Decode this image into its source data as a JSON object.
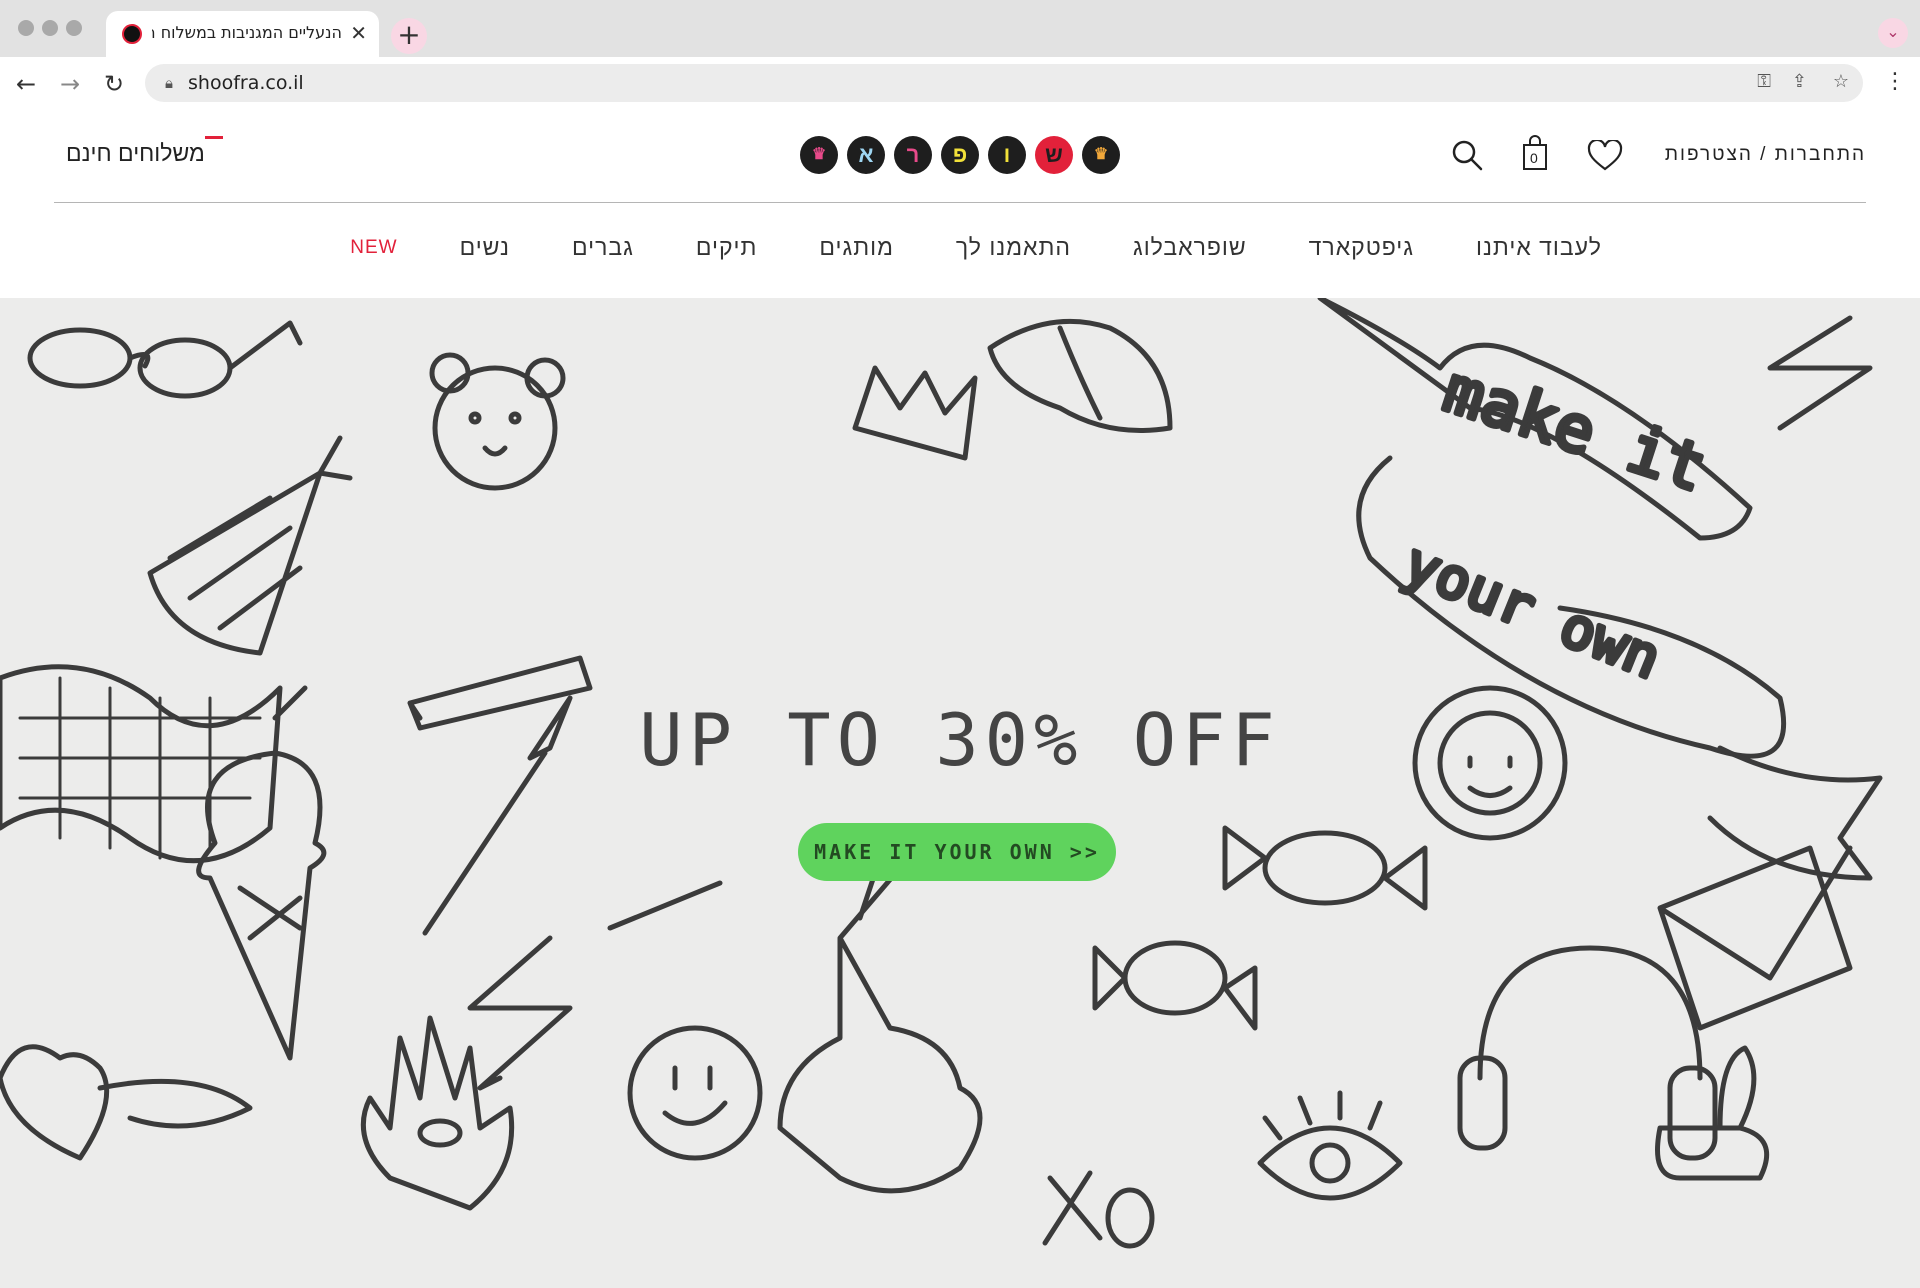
{
  "browser": {
    "tab_title": "הנעליים המגניבות במשלוח חינם עד הבית",
    "tab_close": "✕",
    "new_tab": "+",
    "url": "shoofra.co.il"
  },
  "header": {
    "shipping": "משלוחים חינם",
    "account": "התחברות / הצטרפות",
    "cart_count": "0",
    "logo_letters": [
      "א",
      "ר",
      "פ",
      "ו",
      "ש"
    ]
  },
  "nav": [
    {
      "label": "NEW",
      "highlight": true
    },
    {
      "label": "נשים"
    },
    {
      "label": "גברים"
    },
    {
      "label": "תיקים"
    },
    {
      "label": "מותגים"
    },
    {
      "label": "התאמנו לך"
    },
    {
      "label": "שופראבלוג"
    },
    {
      "label": "גיפטקארד"
    },
    {
      "label": "לעבוד איתנו"
    }
  ],
  "hero": {
    "headline": "UP TO 30% OFF",
    "cta_label": "MAKE IT YOUR OWN >>",
    "banner_line1": "make it",
    "banner_line2": "your own",
    "doodle_text": "XOXO"
  },
  "colors": {
    "brand_red": "#e2213a",
    "cta_green": "#5fd35d",
    "hero_bg": "#ececeb"
  }
}
